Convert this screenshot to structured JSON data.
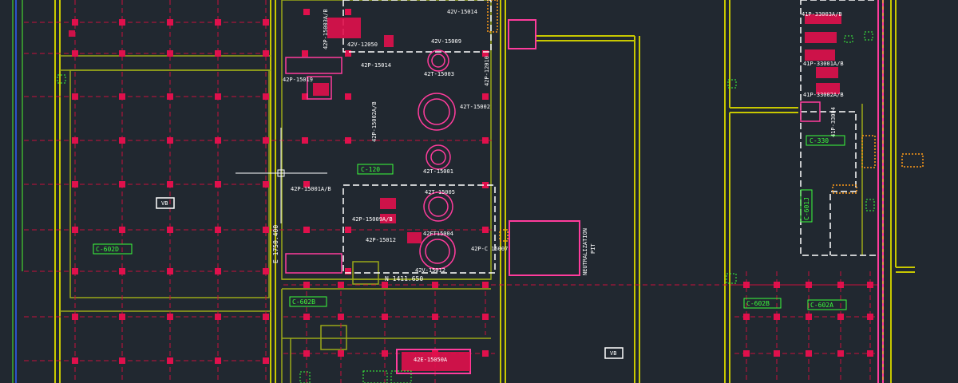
{
  "colors": {
    "background": "#212830",
    "yellow_line": "#d8d800",
    "olive_line": "#a8b020",
    "red_line": "#d01040",
    "magenta": "#ff3c9c",
    "white_dash": "#ffffff",
    "green_box": "#38e038",
    "column": "#e0104c"
  },
  "labels": {
    "v_14014": "42V-15014",
    "v_12050": "42V-12050",
    "v_15009": "42V-15009",
    "p_15014": "42P-15014",
    "p_15019": "42P-15019",
    "t_15003": "42T-15003",
    "p_15002ab": "42P-15002A/B",
    "t_15002": "42T-15002",
    "p_12010": "42P-12010",
    "t_15001": "42T-15001",
    "p_15001ab": "42P-15001A/B",
    "t_15005": "42T-15005",
    "p_15009ab": "42P-15009A/B",
    "ft_15004": "42FT15004",
    "p_15012": "42P-15012",
    "v_15012": "42V-15012",
    "x_15007": "42P-C 15007",
    "p_15003ab": "42P-15003A/B",
    "northing": "N 1411.650",
    "easting": "E 1750.400",
    "e_15050a": "42E-15050A",
    "p_33003ab": "41P-33003A/B",
    "p_33001ab": "41P-33001A/B",
    "p_33002ab": "41P-33002A/B",
    "p_33004": "41P-33004",
    "neutralization_1": "NEUTRALIZATION",
    "neutralization_2": "PIT",
    "vb_1": "VB",
    "vb_2": "VB"
  },
  "areas": {
    "c_120": "C-120",
    "c_602d": "C-602D",
    "c_602b_left": "C-602B",
    "c_602b_right": "C-602B",
    "c_602a": "C-602A",
    "c_330": "C-330",
    "c_601j": "C-601J"
  }
}
